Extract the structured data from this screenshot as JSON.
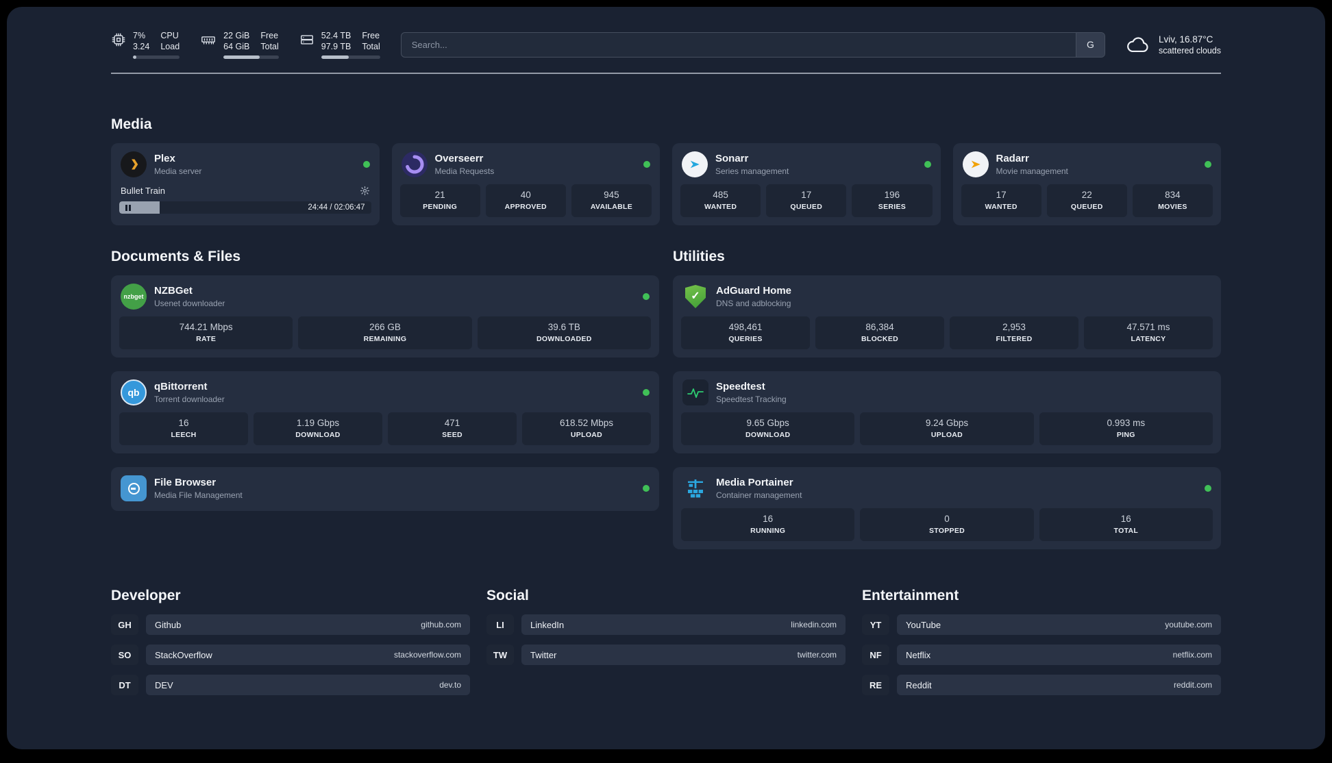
{
  "topbar": {
    "cpu": {
      "percent": "7%",
      "load": "3.24",
      "label_top": "CPU",
      "label_bottom": "Load",
      "progress_pct": 7
    },
    "ram": {
      "free": "22 GiB",
      "total": "64 GiB",
      "label_top": "Free",
      "label_bottom": "Total",
      "progress_pct": 66
    },
    "disk": {
      "free": "52.4 TB",
      "total": "97.9 TB",
      "label_top": "Free",
      "label_bottom": "Total",
      "progress_pct": 47
    },
    "search": {
      "placeholder": "Search...",
      "engine_label": "G"
    },
    "weather": {
      "location": "Lviv, 16.87°C",
      "condition": "scattered clouds"
    }
  },
  "colors": {
    "status_online": "#40c057",
    "plex_accent": "#e8a22b",
    "sonarr_accent": "#23a7de",
    "radarr_accent": "#f1a208",
    "adguard_accent": "#4f9e37",
    "speedtest_accent": "#2ecc71",
    "portainer_accent": "#2ba7df"
  },
  "sections": {
    "media": "Media",
    "documents": "Documents & Files",
    "utilities": "Utilities"
  },
  "apps": {
    "plex": {
      "name": "Plex",
      "desc": "Media server",
      "status": "online",
      "now_playing": "Bullet Train",
      "time": "24:44 / 02:06:47",
      "progress_pct": 16
    },
    "overseerr": {
      "name": "Overseerr",
      "desc": "Media Requests",
      "status": "online",
      "stats": [
        {
          "value": "21",
          "label": "PENDING"
        },
        {
          "value": "40",
          "label": "APPROVED"
        },
        {
          "value": "945",
          "label": "AVAILABLE"
        }
      ]
    },
    "sonarr": {
      "name": "Sonarr",
      "desc": "Series management",
      "status": "online",
      "stats": [
        {
          "value": "485",
          "label": "WANTED"
        },
        {
          "value": "17",
          "label": "QUEUED"
        },
        {
          "value": "196",
          "label": "SERIES"
        }
      ]
    },
    "radarr": {
      "name": "Radarr",
      "desc": "Movie management",
      "status": "online",
      "stats": [
        {
          "value": "17",
          "label": "WANTED"
        },
        {
          "value": "22",
          "label": "QUEUED"
        },
        {
          "value": "834",
          "label": "MOVIES"
        }
      ]
    },
    "nzbget": {
      "name": "NZBGet",
      "desc": "Usenet downloader",
      "status": "online",
      "stats": [
        {
          "value": "744.21 Mbps",
          "label": "RATE"
        },
        {
          "value": "266 GB",
          "label": "REMAINING"
        },
        {
          "value": "39.6 TB",
          "label": "DOWNLOADED"
        }
      ]
    },
    "qbittorrent": {
      "name": "qBittorrent",
      "desc": "Torrent downloader",
      "status": "online",
      "stats": [
        {
          "value": "16",
          "label": "LEECH"
        },
        {
          "value": "1.19 Gbps",
          "label": "DOWNLOAD"
        },
        {
          "value": "471",
          "label": "SEED"
        },
        {
          "value": "618.52 Mbps",
          "label": "UPLOAD"
        }
      ]
    },
    "filebrowser": {
      "name": "File Browser",
      "desc": "Media File Management",
      "status": "online"
    },
    "adguard": {
      "name": "AdGuard Home",
      "desc": "DNS and adblocking",
      "stats": [
        {
          "value": "498,461",
          "label": "QUERIES"
        },
        {
          "value": "86,384",
          "label": "BLOCKED"
        },
        {
          "value": "2,953",
          "label": "FILTERED"
        },
        {
          "value": "47.571 ms",
          "label": "LATENCY"
        }
      ]
    },
    "speedtest": {
      "name": "Speedtest",
      "desc": "Speedtest Tracking",
      "stats": [
        {
          "value": "9.65 Gbps",
          "label": "DOWNLOAD"
        },
        {
          "value": "9.24 Gbps",
          "label": "UPLOAD"
        },
        {
          "value": "0.993 ms",
          "label": "PING"
        }
      ]
    },
    "portainer": {
      "name": "Media Portainer",
      "desc": "Container management",
      "status": "online",
      "stats": [
        {
          "value": "16",
          "label": "RUNNING"
        },
        {
          "value": "0",
          "label": "STOPPED"
        },
        {
          "value": "16",
          "label": "TOTAL"
        }
      ]
    }
  },
  "bookmarks": {
    "developer": {
      "title": "Developer",
      "items": [
        {
          "abbr": "GH",
          "name": "Github",
          "url": "github.com"
        },
        {
          "abbr": "SO",
          "name": "StackOverflow",
          "url": "stackoverflow.com"
        },
        {
          "abbr": "DT",
          "name": "DEV",
          "url": "dev.to"
        }
      ]
    },
    "social": {
      "title": "Social",
      "items": [
        {
          "abbr": "LI",
          "name": "LinkedIn",
          "url": "linkedin.com"
        },
        {
          "abbr": "TW",
          "name": "Twitter",
          "url": "twitter.com"
        }
      ]
    },
    "entertainment": {
      "title": "Entertainment",
      "items": [
        {
          "abbr": "YT",
          "name": "YouTube",
          "url": "youtube.com"
        },
        {
          "abbr": "NF",
          "name": "Netflix",
          "url": "netflix.com"
        },
        {
          "abbr": "RE",
          "name": "Reddit",
          "url": "reddit.com"
        }
      ]
    }
  }
}
